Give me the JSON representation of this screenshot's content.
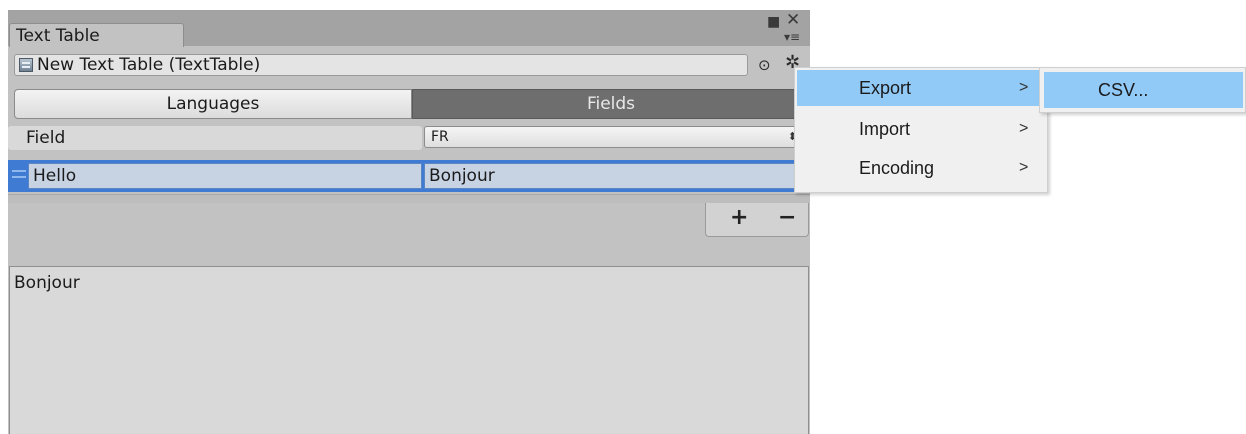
{
  "window": {
    "tab_title": "Text Table",
    "maximize_icon": "maximize-icon",
    "close_icon": "close-icon",
    "menu_icon": "panel-menu-icon"
  },
  "asset": {
    "name": "New Text Table (TextTable)",
    "icon": "text-table-asset-icon",
    "help_icon": "target-icon",
    "settings_icon": "gear-icon"
  },
  "toolbar": {
    "tab_languages": "Languages",
    "tab_fields": "Fields",
    "selected": "Fields"
  },
  "table": {
    "field_header": "Field",
    "language_selected": "FR",
    "rows": [
      {
        "key": "Hello",
        "value": "Bonjour"
      }
    ],
    "add_label": "+",
    "remove_label": "−"
  },
  "preview": {
    "text": "Bonjour"
  },
  "context_menu": {
    "items": [
      {
        "label": "Export",
        "arrow": ">",
        "highlighted": true
      },
      {
        "label": "Import",
        "arrow": ">",
        "highlighted": false
      },
      {
        "label": "Encoding",
        "arrow": ">",
        "highlighted": false
      }
    ],
    "submenu": {
      "items": [
        {
          "label": "CSV...",
          "highlighted": true
        }
      ]
    }
  },
  "colors": {
    "selection_row": "#3f7ad3",
    "menu_highlight": "#91c9f7",
    "segment_active": "#6e6e6e"
  }
}
